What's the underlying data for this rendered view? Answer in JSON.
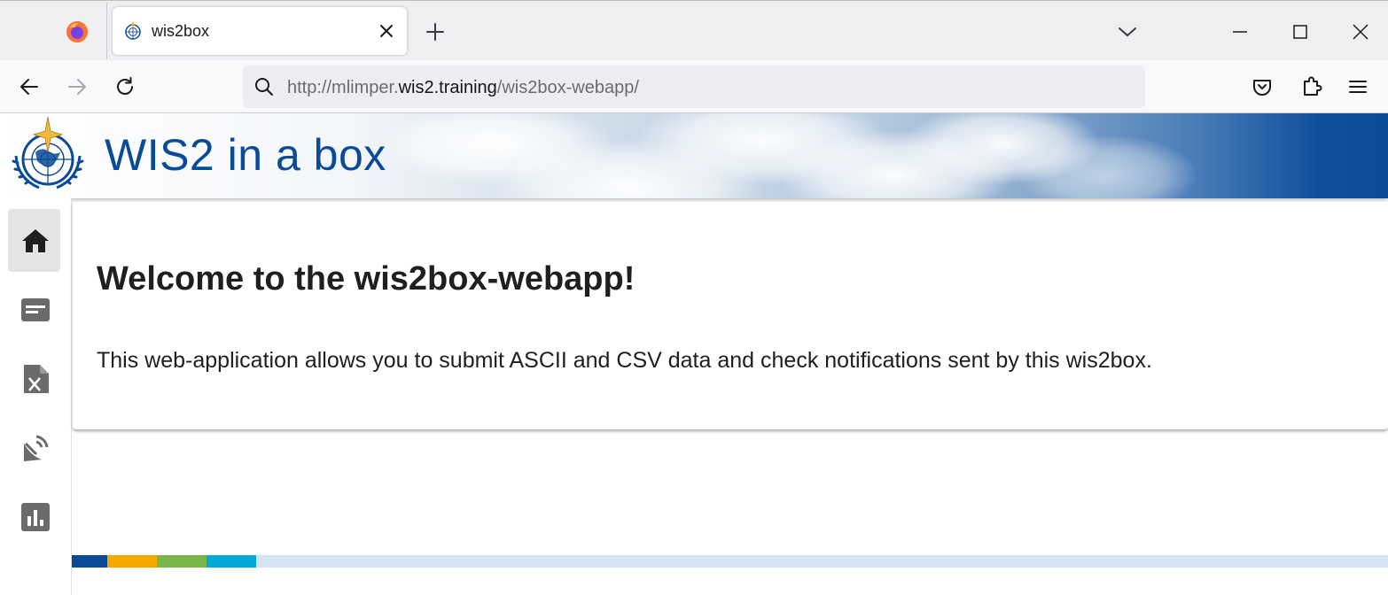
{
  "browser": {
    "tab_title": "wis2box",
    "url_prefix": "http://mlimper.",
    "url_host": "wis2.training",
    "url_path": "/wis2box-webapp/"
  },
  "banner": {
    "title": "WIS2 in a box"
  },
  "sidebar": {
    "items": [
      {
        "icon": "home-icon",
        "active": true
      },
      {
        "icon": "message-icon",
        "active": false
      },
      {
        "icon": "csv-file-icon",
        "active": false
      },
      {
        "icon": "satellite-dish-icon",
        "active": false
      },
      {
        "icon": "bar-chart-icon",
        "active": false
      }
    ]
  },
  "main": {
    "heading": "Welcome to the wis2box-webapp!",
    "description": "This web-application allows you to submit ASCII and CSV data and check notifications sent by this wis2box."
  },
  "colors": {
    "brand_blue": "#0a4a97",
    "footer_blue": "#0a4a97",
    "footer_orange": "#f5a800",
    "footer_green": "#7ab648",
    "footer_cyan": "#00a9d6",
    "footer_light": "#d5e4f2"
  }
}
